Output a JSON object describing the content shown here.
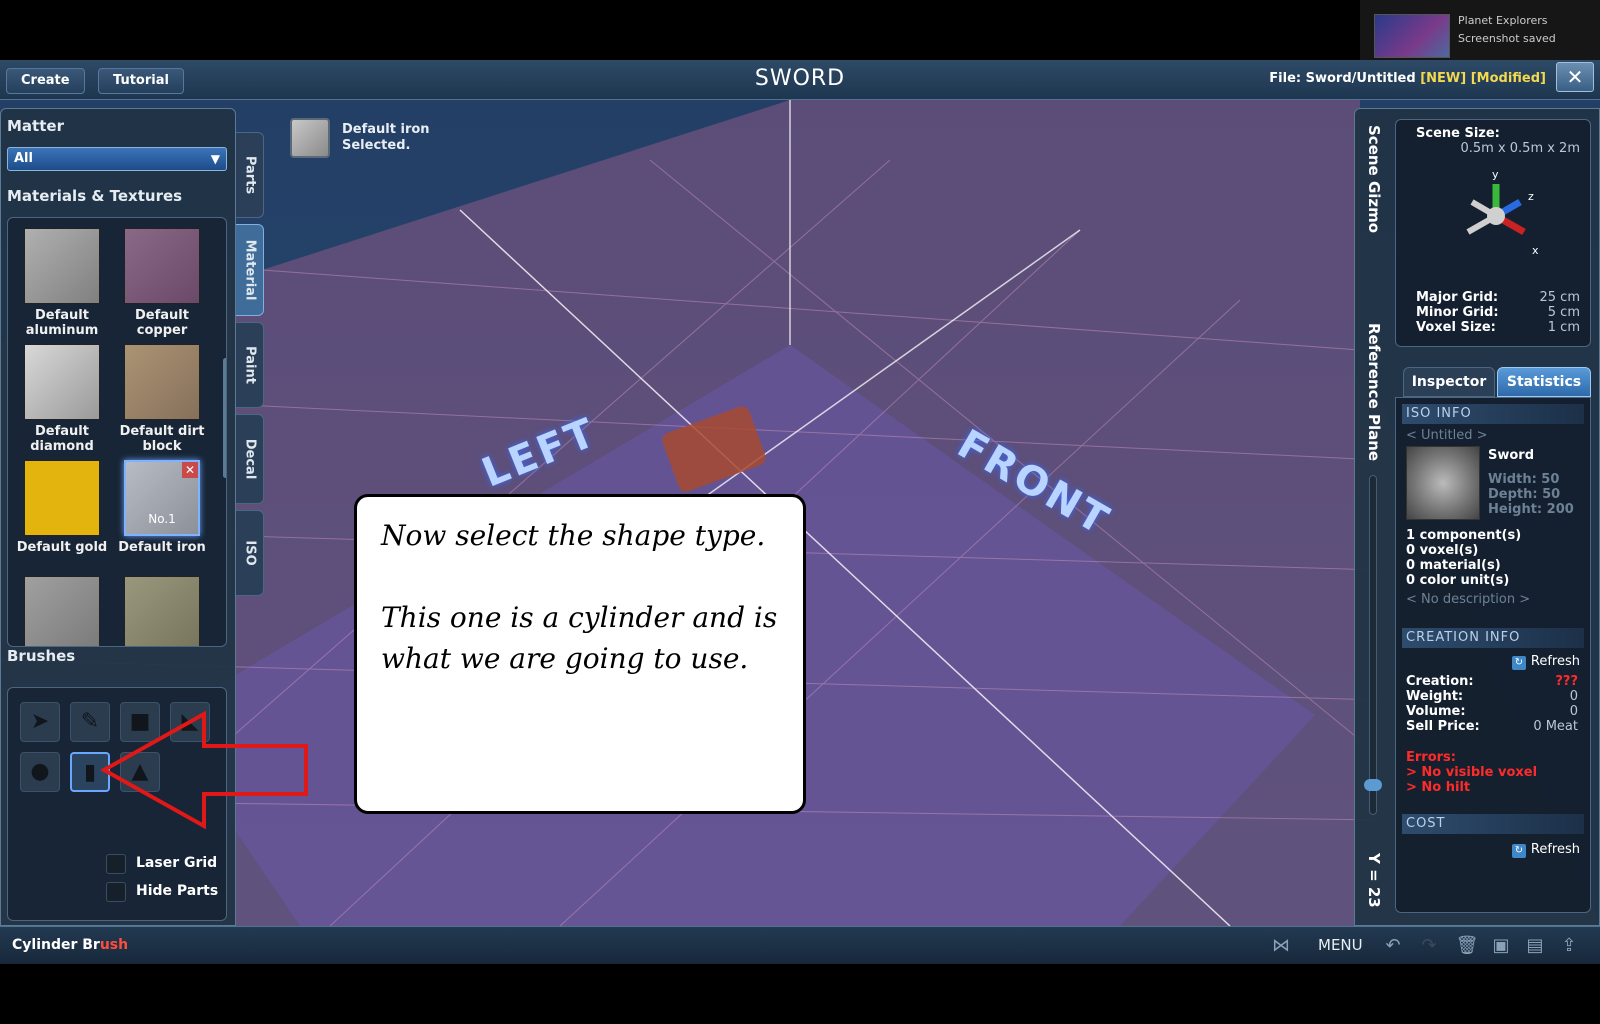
{
  "notification": {
    "title": "Planet Explorers",
    "message": "Screenshot saved"
  },
  "topbar": {
    "tabs": [
      "Create",
      "Tutorial"
    ],
    "title": "SWORD",
    "file_label": "File:",
    "file_name": "Sword/Untitled",
    "flag_new": "[NEW]",
    "flag_modified": "[Modified]",
    "close": "✕"
  },
  "left": {
    "matter_title": "Matter",
    "matter_value": "All",
    "materials_title": "Materials & Textures",
    "materials": [
      {
        "label": "Default aluminum",
        "color": "#9a9a9a"
      },
      {
        "label": "Default copper",
        "color": "#7a5a78"
      },
      {
        "label": "Default diamond",
        "color": "#b8b8b8"
      },
      {
        "label": "Default dirt block",
        "color": "#9a8466"
      },
      {
        "label": "Default gold",
        "color": "#e3b40e"
      },
      {
        "label": "Default iron",
        "color": "#a7aab0",
        "badge": "No.1"
      },
      {
        "label": "",
        "color": "#8f8f8f"
      },
      {
        "label": "",
        "color": "#8a8870"
      }
    ],
    "brushes_title": "Brushes",
    "brushes": [
      "select-brush",
      "pencil-brush",
      "box-brush",
      "wedge-brush",
      "sphere-brush",
      "cylinder-brush",
      "cone-brush"
    ],
    "laser_grid": "Laser Grid",
    "hide_parts": "Hide Parts",
    "vertical_tabs": [
      "Parts",
      "Material",
      "Paint",
      "Decal",
      "ISO"
    ]
  },
  "viewport": {
    "selected_line1": "Default iron",
    "selected_line2": "Selected.",
    "label_left": "LEFT",
    "label_front": "FRONT",
    "grid_color": "#c86a9a"
  },
  "callout": {
    "text": "Now select the shape type.\n\nThis one is a cylinder and is what we are going to use."
  },
  "right": {
    "scene_gizmo": "Scene Gizmo",
    "reference_plane": "Reference Plane",
    "y_value": "Y = 23",
    "scene_size_label": "Scene Size:",
    "scene_size_value": "0.5m x 0.5m x 2m",
    "axis_y": "y",
    "axis_z": "z",
    "axis_x": "x",
    "major_grid_label": "Major Grid:",
    "major_grid_value": "25 cm",
    "minor_grid_label": "Minor Grid:",
    "minor_grid_value": "5 cm",
    "voxel_size_label": "Voxel Size:",
    "voxel_size_value": "1 cm",
    "tab_inspector": "Inspector",
    "tab_statistics": "Statistics",
    "iso_info": "ISO INFO",
    "untitled": "< Untitled >",
    "iso_name": "Sword",
    "width": "Width: 50",
    "depth": "Depth: 50",
    "height": "Height: 200",
    "components": "1 component(s)",
    "voxels": "0 voxel(s)",
    "materials": "0 material(s)",
    "color_units": "0 color unit(s)",
    "no_description": "< No description >",
    "creation_info": "CREATION INFO",
    "refresh": "Refresh",
    "creation_label": "Creation:",
    "creation_value": "???",
    "weight_label": "Weight:",
    "weight_value": "0",
    "volume_label": "Volume:",
    "volume_value": "0",
    "sell_label": "Sell Price:",
    "sell_value": "0 Meat",
    "errors_label": "Errors:",
    "error1": "> No visible voxel",
    "error2": "> No hilt",
    "cost": "COST"
  },
  "bottombar": {
    "status_a": "Cylinder Br",
    "status_b": "ush",
    "menu": "MENU"
  }
}
